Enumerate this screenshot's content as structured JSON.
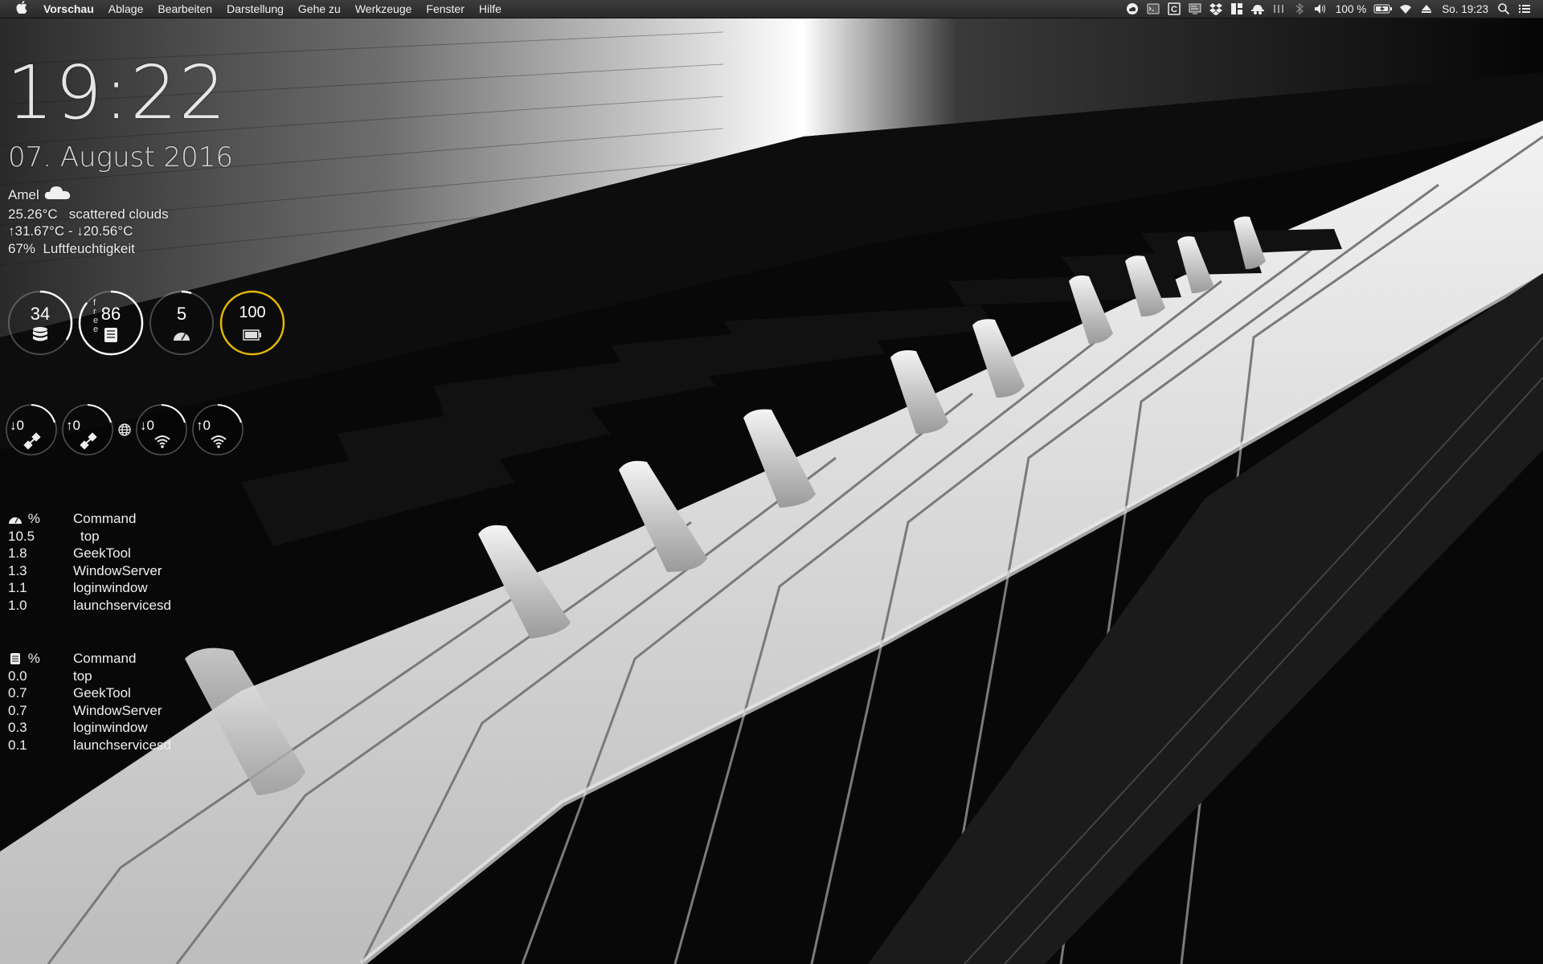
{
  "menubar": {
    "apple_icon": "apple-icon",
    "app_name": "Vorschau",
    "items": [
      "Ablage",
      "Bearbeiten",
      "Darstellung",
      "Gehe zu",
      "Werkzeuge",
      "Fenster",
      "Hilfe"
    ],
    "battery_percent": "100 %",
    "datetime": "So. 19:23",
    "status_icons": [
      "creative-cloud-icon",
      "terminal-icon",
      "clipboard-c-icon",
      "screen-icon",
      "dropbox-icon",
      "layout-icon",
      "incognito-icon",
      "equalizer-icon",
      "bluetooth-icon",
      "volume-icon",
      "battery-icon",
      "wifi-icon",
      "eject-icon",
      "spotlight-icon",
      "notification-center-icon"
    ]
  },
  "clock": {
    "time": "19:22",
    "date": "07. August 2016"
  },
  "weather": {
    "city": "Amel",
    "icon": "cloud-icon",
    "temp_line": "25.26°C   scattered clouds",
    "range_line": "↑31.67°C - ↓20.56°C",
    "humidity_line": "67%  Luftfeuchtigkeit"
  },
  "gauges": [
    {
      "id": "ram",
      "value": "34",
      "icon": "database-icon",
      "fraction": 0.34,
      "color": "#ffffff"
    },
    {
      "id": "disk",
      "value": "86",
      "icon": "drive-icon",
      "fraction": 0.86,
      "color": "#ffffff",
      "side_label": "f\nr\ne\ne"
    },
    {
      "id": "cpu",
      "value": "5",
      "icon": "speedometer-icon",
      "fraction": 0.05,
      "color": "#ffffff"
    },
    {
      "id": "battery",
      "value": "100",
      "icon": "battery-icon",
      "fraction": 1.0,
      "color": "#e6b800"
    }
  ],
  "network": [
    {
      "id": "eth-down",
      "value": "↓0",
      "icon": "ethernet-icon"
    },
    {
      "id": "eth-up",
      "value": "↑0",
      "icon": "ethernet-icon"
    },
    {
      "id": "wifi-down",
      "value": "↓0",
      "icon": "wifi-icon"
    },
    {
      "id": "wifi-up",
      "value": "↑0",
      "icon": "wifi-icon"
    }
  ],
  "globe_icon": "globe-icon",
  "cpu_processes": {
    "header_icon": "speedometer-icon",
    "header_pct": "%",
    "header_cmd": "Command",
    "rows": [
      {
        "pct": "10.5",
        "cmd": "top"
      },
      {
        "pct": "1.8",
        "cmd": "GeekTool"
      },
      {
        "pct": "1.3",
        "cmd": "WindowServer"
      },
      {
        "pct": "1.1",
        "cmd": "loginwindow"
      },
      {
        "pct": "1.0",
        "cmd": "launchservicesd"
      }
    ]
  },
  "mem_processes": {
    "header_icon": "memory-icon",
    "header_pct": "%",
    "header_cmd": "Command",
    "rows": [
      {
        "pct": "0.0",
        "cmd": "top"
      },
      {
        "pct": "0.7",
        "cmd": "GeekTool"
      },
      {
        "pct": "0.7",
        "cmd": "WindowServer"
      },
      {
        "pct": "0.3",
        "cmd": "loginwindow"
      },
      {
        "pct": "0.1",
        "cmd": "launchservicesd"
      }
    ]
  }
}
